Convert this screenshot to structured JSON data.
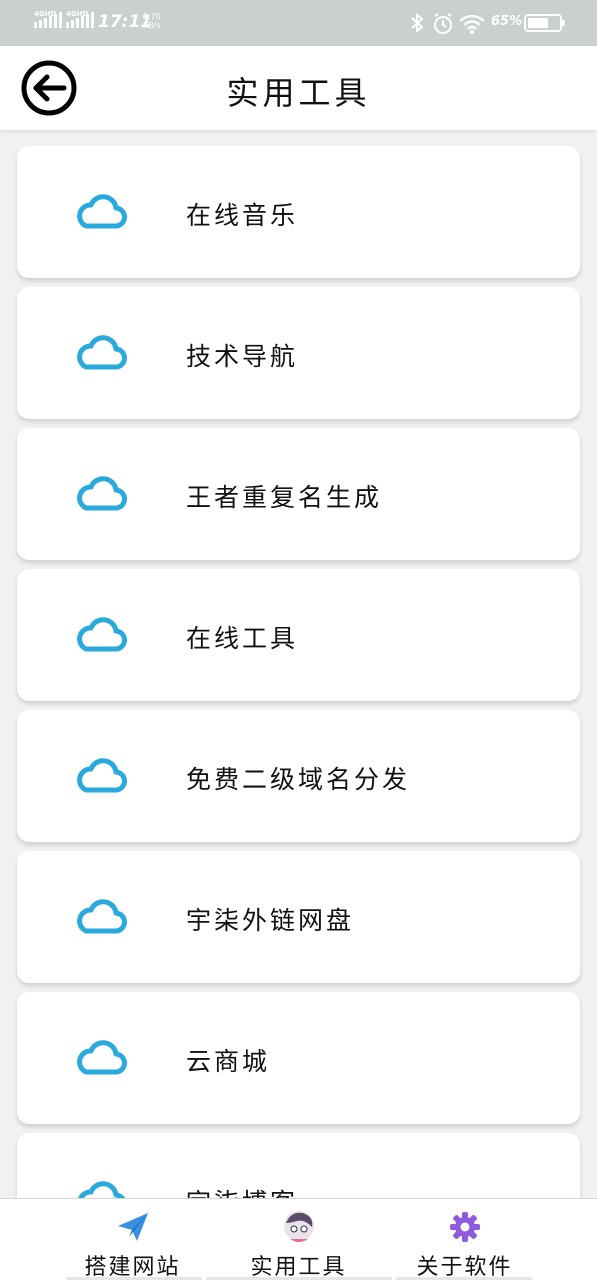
{
  "status_bar": {
    "sim1": "4GHD",
    "sim2": "4GHD",
    "time": "17:11",
    "net_speed_value": "0.70",
    "net_speed_unit": "KB/s",
    "battery_percent": "65%",
    "battery_level": 0.65
  },
  "header": {
    "title": "实用工具",
    "back_icon": "back-arrow-circle-icon"
  },
  "tools": [
    {
      "label": "在线音乐",
      "icon": "cloud-icon"
    },
    {
      "label": "技术导航",
      "icon": "cloud-icon"
    },
    {
      "label": "王者重复名生成",
      "icon": "cloud-icon"
    },
    {
      "label": "在线工具",
      "icon": "cloud-icon"
    },
    {
      "label": "免费二级域名分发",
      "icon": "cloud-icon"
    },
    {
      "label": "宇柒外链网盘",
      "icon": "cloud-icon"
    },
    {
      "label": "云商城",
      "icon": "cloud-icon"
    },
    {
      "label": "宇柒博客",
      "icon": "cloud-icon"
    }
  ],
  "bottom_nav": [
    {
      "label": "搭建网站",
      "icon": "paper-plane-icon"
    },
    {
      "label": "实用工具",
      "icon": "anime-avatar-icon",
      "active": true
    },
    {
      "label": "关于软件",
      "icon": "gear-icon"
    }
  ],
  "colors": {
    "accent_cloud": "#29a9dc",
    "status_bar_bg": "#c9d0cf",
    "page_bg": "#f1f1f1",
    "card_bg": "#ffffff"
  }
}
